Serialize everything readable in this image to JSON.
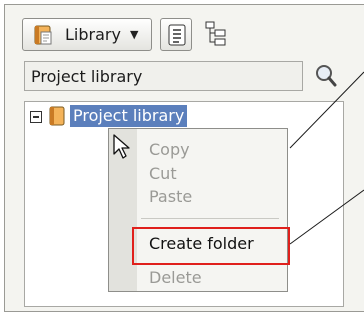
{
  "toolbar": {
    "library_label": "Library",
    "library_caret": "▼"
  },
  "search": {
    "value": "Project library"
  },
  "tree": {
    "root_label": "Project library"
  },
  "context_menu": {
    "items": [
      {
        "label": "Copy",
        "enabled": false
      },
      {
        "label": "Cut",
        "enabled": false
      },
      {
        "label": "Paste",
        "enabled": false
      },
      {
        "label": "Create folder",
        "enabled": true
      },
      {
        "label": "Delete",
        "enabled": false
      }
    ]
  },
  "colors": {
    "selection": "#5b7fbc",
    "highlight_border": "#e0201c",
    "disabled_text": "#9a9a96"
  },
  "icons": [
    "library-icon",
    "chevron-down-icon",
    "list-view-icon",
    "tree-view-icon",
    "search-icon",
    "book-icon",
    "collapse-icon",
    "mouse-cursor-icon"
  ]
}
